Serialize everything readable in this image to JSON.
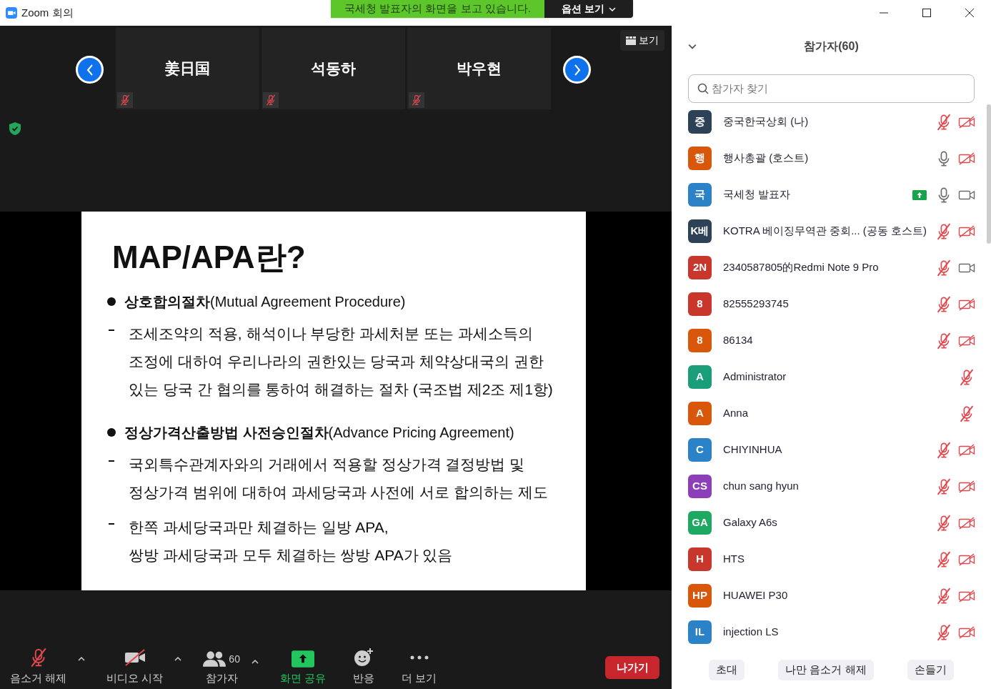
{
  "window": {
    "title": "Zoom 회의"
  },
  "banner": {
    "text": "국세청 발표자의 화면을 보고 있습니다.",
    "options": "옵션 보기"
  },
  "view_button": "보기",
  "thumbnails": [
    {
      "name": "姜日国",
      "muted": true
    },
    {
      "name": "석동하",
      "muted": true
    },
    {
      "name": "박우현",
      "muted": true
    }
  ],
  "slide": {
    "title": "MAP/APA란?",
    "sections": [
      {
        "heading": "**상호합의절차**(Mutual Agreement Procedure)",
        "items": [
          [
            "조세조약의 적용, 해석이나 부당한 과세처분 또는 과세소득의",
            "조정에 대하여 우리나라의 권한있는 당국과 체약상대국의 권한",
            "있는 당국 간 협의를 통하여 해결하는 절차 (국조법 제2조 제1항)"
          ]
        ]
      },
      {
        "heading": "**정상가격산출방법 사전승인절차**(Advance Pricing Agreement)",
        "items": [
          [
            "국외특수관계자와의 거래에서 적용할 정상가격 결정방법 및",
            "정상가격 범위에 대하여 과세당국과 사전에 서로 합의하는 제도"
          ],
          [
            "한쪽 과세당국과만 체결하는 일방 APA,",
            "쌍방 과세당국과 모두 체결하는 쌍방 APA가 있음"
          ]
        ]
      }
    ]
  },
  "toolbar": [
    {
      "kind": "mic",
      "label": "음소거 해제",
      "off": true
    },
    {
      "kind": "video",
      "label": "비디오 시작",
      "off": true
    },
    {
      "kind": "participants",
      "label": "참가자",
      "count": "60"
    },
    {
      "kind": "share",
      "label": "화면 공유"
    },
    {
      "kind": "reactions",
      "label": "반응"
    },
    {
      "kind": "more",
      "label": "더 보기"
    }
  ],
  "leave_button": "나가기",
  "panel": {
    "title": "참가자(60)",
    "search": {
      "placeholder": "참가자 찾기"
    },
    "participants": [
      {
        "avatar": "중",
        "name": "중국한국상회 (나)",
        "color": "#2d4256",
        "sharing": false,
        "mic_muted": true,
        "video_off": true
      },
      {
        "avatar": "행",
        "name": "행사총괄 (호스트)",
        "color": "#d9570b",
        "sharing": false,
        "mic_muted": false,
        "video_off": true
      },
      {
        "avatar": "국",
        "name": "국세청 발표자",
        "color": "#2b82c6",
        "sharing": true,
        "mic_muted": false,
        "video_off": false
      },
      {
        "avatar": "K베",
        "name": "KOTRA 베이징무역관 중회...  (공동 호스트)",
        "color": "#2d4256",
        "sharing": false,
        "mic_muted": true,
        "video_off": true
      },
      {
        "avatar": "2N",
        "name": "2340587805的Redmi Note 9 Pro",
        "color": "#c9372c",
        "sharing": false,
        "mic_muted": true,
        "video_off": false
      },
      {
        "avatar": "8",
        "name": "82555293745",
        "color": "#c9372c",
        "sharing": false,
        "mic_muted": true,
        "video_off": true
      },
      {
        "avatar": "8",
        "name": "86134",
        "color": "#d9570b",
        "sharing": false,
        "mic_muted": true,
        "video_off": true
      },
      {
        "avatar": "A",
        "name": "Administrator",
        "color": "#1a9e7a",
        "sharing": false,
        "mic_muted": true
      },
      {
        "avatar": "A",
        "name": "Anna",
        "color": "#d9570b",
        "sharing": false,
        "mic_muted": true
      },
      {
        "avatar": "C",
        "name": "CHIYINHUA",
        "color": "#2b82c6",
        "sharing": false,
        "mic_muted": true,
        "video_off": true
      },
      {
        "avatar": "CS",
        "name": "chun sang hyun",
        "color": "#8c3fb8",
        "sharing": false,
        "mic_muted": true,
        "video_off": true
      },
      {
        "avatar": "GA",
        "name": "Galaxy A6s",
        "color": "#1fa862",
        "sharing": false,
        "mic_muted": true,
        "video_off": true
      },
      {
        "avatar": "H",
        "name": "HTS",
        "color": "#c9372c",
        "sharing": false,
        "mic_muted": true,
        "video_off": true
      },
      {
        "avatar": "HP",
        "name": "HUAWEI P30",
        "color": "#d9570b",
        "sharing": false,
        "mic_muted": true,
        "video_off": true
      },
      {
        "avatar": "IL",
        "name": "injection LS",
        "color": "#2b82c6",
        "sharing": false,
        "mic_muted": true,
        "video_off": true
      }
    ],
    "buttons": [
      "초대",
      "나만 음소거 해제",
      "손들기"
    ]
  }
}
